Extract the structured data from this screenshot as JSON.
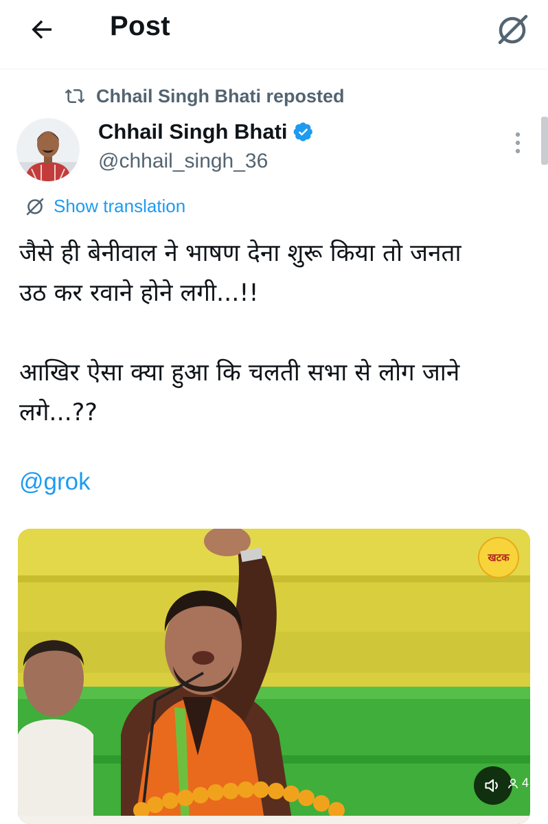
{
  "header": {
    "title": "Post",
    "back_icon": "arrow-left-icon",
    "grok_icon": "grok-icon"
  },
  "repost": {
    "icon": "repost-icon",
    "text": "Chhail Singh Bhati reposted"
  },
  "author": {
    "name": "Chhail Singh Bhati",
    "handle": "@chhail_singh_36",
    "verified": true,
    "verified_color": "#1d9bf0"
  },
  "translation": {
    "label": "Show translation",
    "icon": "translate-icon"
  },
  "tweet": {
    "line1": "जैसे ही बेनीवाल ने भाषण देना शुरू किया तो जनता",
    "line2": "उठ कर रवाने होने लगी...!!",
    "line3": "आखिर ऐसा क्या हुआ कि चलती सभा से लोग जाने",
    "line4": "लगे...??",
    "mention": "@grok"
  },
  "media": {
    "type": "video",
    "channel_logo_text": "खटक",
    "volume_icon": "volume-icon",
    "view_count": "4"
  },
  "colors": {
    "accent": "#1d9bf0",
    "secondary_text": "#536471",
    "primary_text": "#0f1419"
  }
}
